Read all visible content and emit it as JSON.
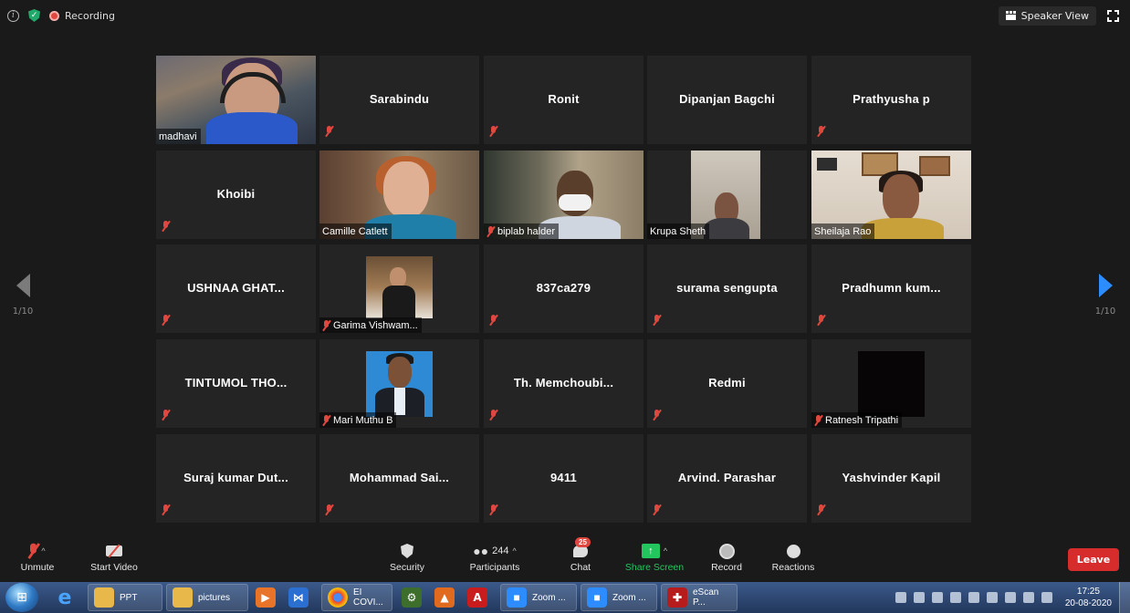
{
  "topbar": {
    "recording_label": "Recording",
    "speaker_view_label": "Speaker View"
  },
  "nav": {
    "left_page": "1/10",
    "right_page": "1/10"
  },
  "tiles": [
    {
      "name": "madhavi",
      "type": "video",
      "muted": false
    },
    {
      "name": "Sarabindu",
      "type": "name",
      "muted": true
    },
    {
      "name": "Ronit",
      "type": "name",
      "muted": true
    },
    {
      "name": "Dipanjan Bagchi",
      "type": "name",
      "muted": false
    },
    {
      "name": "Prathyusha p",
      "type": "name",
      "muted": true
    },
    {
      "name": "Khoibi",
      "type": "name",
      "muted": true
    },
    {
      "name": "Camille Catlett",
      "type": "video",
      "muted": false
    },
    {
      "name": "biplab halder",
      "type": "video",
      "muted": true
    },
    {
      "name": "Krupa Sheth",
      "type": "video",
      "muted": false
    },
    {
      "name": "Sheilaja Rao",
      "type": "video",
      "muted": false
    },
    {
      "name": "USHNAA GHAT...",
      "type": "name",
      "muted": true
    },
    {
      "name": "Garima Vishwam...",
      "type": "thumb",
      "muted": true
    },
    {
      "name": "837ca279",
      "type": "name",
      "muted": true
    },
    {
      "name": "surama sengupta",
      "type": "name",
      "muted": true
    },
    {
      "name": "Pradhumn  kum...",
      "type": "name",
      "muted": true
    },
    {
      "name": "TINTUMOL THO...",
      "type": "name",
      "muted": true
    },
    {
      "name": "Mari Muthu B",
      "type": "thumb",
      "muted": true
    },
    {
      "name": "Th. Memchoubi...",
      "type": "name",
      "muted": true
    },
    {
      "name": "Redmi",
      "type": "name",
      "muted": true
    },
    {
      "name": "Ratnesh Tripathi",
      "type": "thumb",
      "muted": true
    },
    {
      "name": "Suraj kumar Dut...",
      "type": "name",
      "muted": true
    },
    {
      "name": "Mohammad  Sai...",
      "type": "name",
      "muted": true
    },
    {
      "name": "9411",
      "type": "name",
      "muted": true
    },
    {
      "name": "Arvind. Parashar",
      "type": "name",
      "muted": true
    },
    {
      "name": "Yashvinder Kapil",
      "type": "name",
      "muted": true
    }
  ],
  "toolbar": {
    "unmute": "Unmute",
    "start_video": "Start Video",
    "security": "Security",
    "participants": "Participants",
    "participants_count": "244",
    "chat": "Chat",
    "chat_badge": "25",
    "share_screen": "Share Screen",
    "record": "Record",
    "reactions": "Reactions",
    "leave": "Leave"
  },
  "taskbar": {
    "items": [
      "PPT",
      "pictures",
      "EI COVI...",
      "Zoom ...",
      "Zoom ...",
      "eScan P..."
    ],
    "time": "17:25",
    "date": "20-08-2020"
  },
  "colors": {
    "active_border": "#e2f06a",
    "muted_red": "#e0483f",
    "share_green": "#23c55e",
    "leave_red": "#d72c2c",
    "nav_blue": "#2d8cff"
  }
}
